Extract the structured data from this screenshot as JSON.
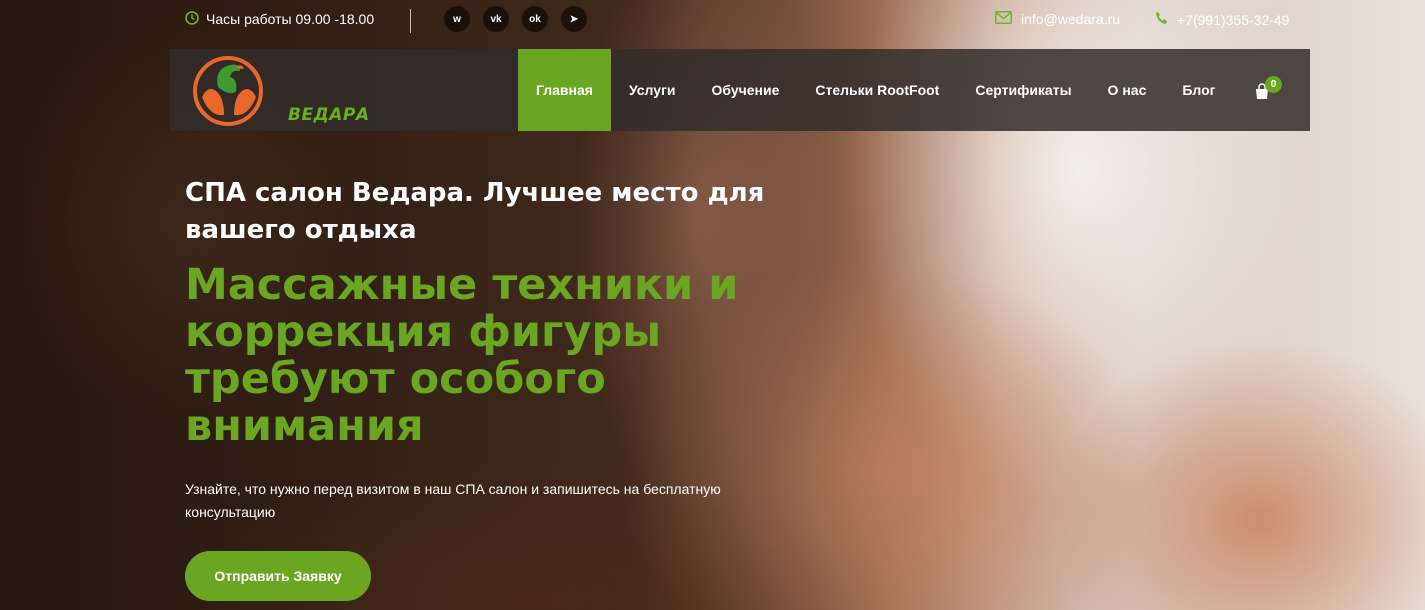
{
  "topbar": {
    "hours": "Часы работы 09.00 -18.00",
    "email": "info@wedara.ru",
    "phone": "+7(991)355-32-49",
    "socials": [
      {
        "name": "whatsapp-icon",
        "glyph": "w"
      },
      {
        "name": "vk-icon",
        "glyph": "vk"
      },
      {
        "name": "odnoklassniki-icon",
        "glyph": "ok"
      },
      {
        "name": "telegram-icon",
        "glyph": "➤"
      }
    ]
  },
  "logo": {
    "text": "ВЕДАРА"
  },
  "nav": {
    "items": [
      {
        "label": "Главная",
        "active": true
      },
      {
        "label": "Услуги"
      },
      {
        "label": "Обучение"
      },
      {
        "label": "Стельки RootFoot"
      },
      {
        "label": "Сертификаты"
      },
      {
        "label": "О нас"
      },
      {
        "label": "Блог"
      }
    ],
    "cart_count": "0"
  },
  "hero": {
    "subtitle": "СПА салон Ведара. Лучшее место для вашего отдыха",
    "headline": "Массажные техники и коррекция фигуры требуют особого внимания",
    "description": "Узнайте, что нужно перед визитом в наш СПА салон и запишитесь на бесплатную консультацию",
    "cta": "Отправить Заявку"
  },
  "colors": {
    "accent": "#6aa621",
    "navbar": "#322d2a",
    "logo_orange": "#e8672a"
  }
}
